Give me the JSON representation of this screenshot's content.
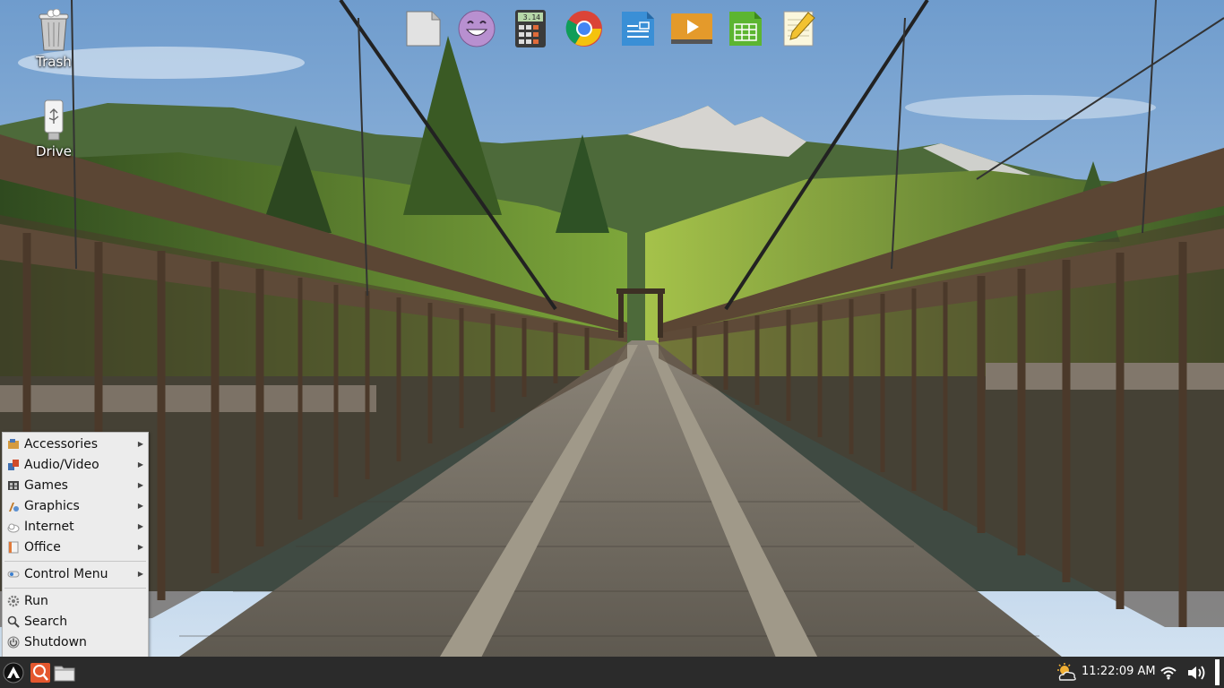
{
  "desktop": {
    "icons": [
      {
        "label": "Trash",
        "icon": "trash-icon"
      },
      {
        "label": "Drive",
        "icon": "usb-drive-icon"
      }
    ]
  },
  "dock": {
    "items": [
      {
        "icon": "files-icon"
      },
      {
        "icon": "pidgin-smiley-icon"
      },
      {
        "icon": "calculator-icon",
        "display": "3.14"
      },
      {
        "icon": "chrome-icon"
      },
      {
        "icon": "writer-document-icon"
      },
      {
        "icon": "media-player-icon"
      },
      {
        "icon": "spreadsheet-icon"
      },
      {
        "icon": "text-editor-icon"
      }
    ]
  },
  "menu": {
    "categories": [
      {
        "label": "Accessories",
        "icon": "accessories-icon"
      },
      {
        "label": "Audio/Video",
        "icon": "audio-video-icon"
      },
      {
        "label": "Games",
        "icon": "games-icon"
      },
      {
        "label": "Graphics",
        "icon": "graphics-icon"
      },
      {
        "label": "Internet",
        "icon": "internet-icon"
      },
      {
        "label": "Office",
        "icon": "office-icon"
      }
    ],
    "control": {
      "label": "Control Menu",
      "icon": "control-menu-icon"
    },
    "actions": [
      {
        "label": "Run",
        "icon": "run-gear-icon"
      },
      {
        "label": "Search",
        "icon": "search-icon"
      },
      {
        "label": "Shutdown",
        "icon": "power-icon"
      }
    ]
  },
  "taskbar": {
    "start": {
      "icon": "start-menu-logo-icon"
    },
    "quicklaunch": [
      {
        "icon": "app-finder-icon"
      },
      {
        "icon": "file-manager-icon"
      }
    ],
    "tray": {
      "weather_icon": "weather-partly-cloudy-icon",
      "clock": "11:22:09 AM",
      "network_icon": "wifi-icon",
      "volume_icon": "volume-icon"
    }
  },
  "colors": {
    "taskbar_bg": "#2b2b2b",
    "menu_bg": "#ececec"
  }
}
